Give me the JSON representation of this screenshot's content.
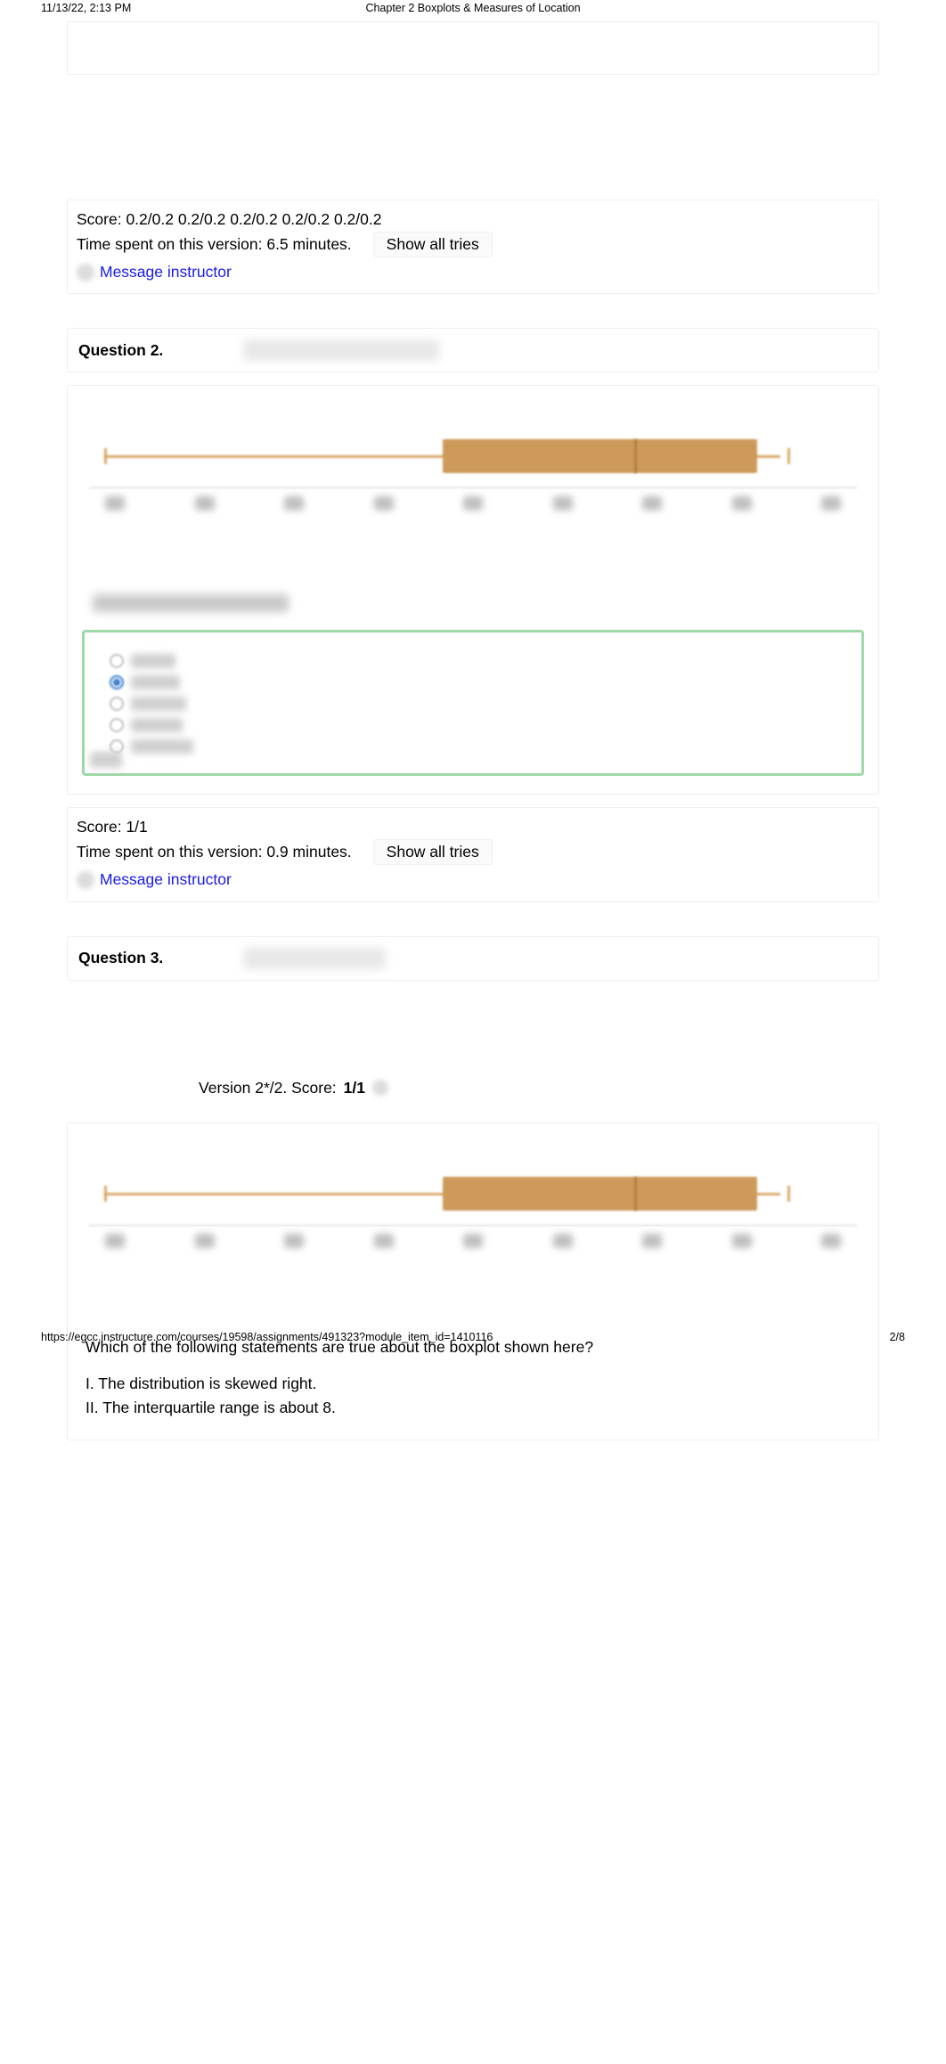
{
  "print": {
    "datetime": "11/13/22, 2:13 PM",
    "title": "Chapter 2 Boxplots & Measures of Location",
    "url": "https://egcc.instructure.com/courses/19598/assignments/491323?module_item_id=1410116",
    "page": "2/8"
  },
  "q1": {
    "score_line": "Score: 0.2/0.2 0.2/0.2 0.2/0.2 0.2/0.2 0.2/0.2",
    "time_line": "Time spent on this version: 6.5 minutes.",
    "show_tries": "Show all tries",
    "msg": "Message instructor"
  },
  "q2": {
    "header": "Question 2.",
    "score_line": "Score: 1/1",
    "time_line": "Time spent on this version: 0.9 minutes.",
    "show_tries": "Show all tries",
    "msg": "Message instructor"
  },
  "q3": {
    "header": "Question 3.",
    "version_prefix": "Version 2*/2. Score: ",
    "version_score": "1/1",
    "prompt": "Which of the following statements are true about the boxplot shown here?",
    "stmt1": "I. The distribution is skewed right.",
    "stmt2": "II. The interquartile range is about 8."
  },
  "chart_data": [
    {
      "type": "boxplot",
      "title": "",
      "xlabel": "",
      "xlim": [
        0,
        45
      ],
      "ticks": [
        0,
        5,
        10,
        15,
        20,
        25,
        30,
        35,
        40
      ],
      "min": 0,
      "q1": 20,
      "median": 31,
      "q3": 38,
      "max": 41
    },
    {
      "type": "boxplot",
      "title": "",
      "xlabel": "",
      "xlim": [
        0,
        45
      ],
      "ticks": [
        0,
        5,
        10,
        15,
        20,
        25,
        30,
        35,
        40
      ],
      "min": 0,
      "q1": 20,
      "median": 31,
      "q3": 38,
      "max": 41
    }
  ]
}
